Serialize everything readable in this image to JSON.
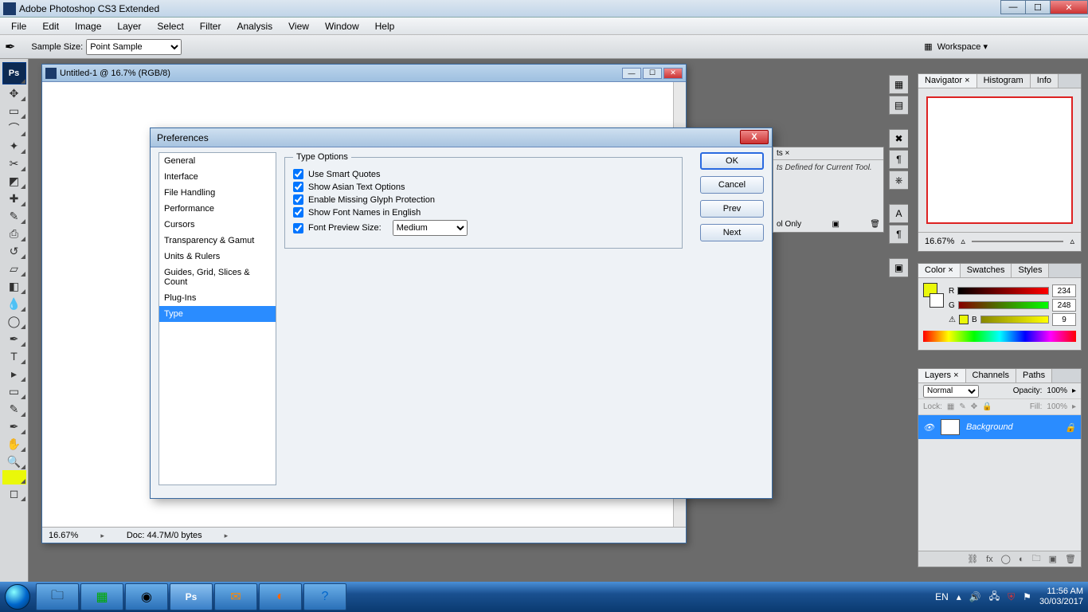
{
  "app": {
    "title": "Adobe Photoshop CS3 Extended"
  },
  "menubar": [
    "File",
    "Edit",
    "Image",
    "Layer",
    "Select",
    "Filter",
    "Analysis",
    "View",
    "Window",
    "Help"
  ],
  "options": {
    "sample_label": "Sample Size:",
    "sample_value": "Point Sample",
    "workspace": "Workspace ▾"
  },
  "doc": {
    "title": "Untitled-1 @ 16.7% (RGB/8)",
    "zoom": "16.67%",
    "docinfo": "Doc: 44.7M/0 bytes"
  },
  "pref": {
    "title": "Preferences",
    "categories": [
      "General",
      "Interface",
      "File Handling",
      "Performance",
      "Cursors",
      "Transparency & Gamut",
      "Units & Rulers",
      "Guides, Grid, Slices & Count",
      "Plug-Ins",
      "Type"
    ],
    "selected": "Type",
    "group": "Type Options",
    "checks": [
      {
        "label": "Use Smart Quotes",
        "checked": true
      },
      {
        "label": "Show Asian Text Options",
        "checked": true
      },
      {
        "label": "Enable Missing Glyph Protection",
        "checked": true
      },
      {
        "label": "Show Font Names in English",
        "checked": true
      }
    ],
    "preview": {
      "label": "Font Preview Size:",
      "checked": true,
      "value": "Medium"
    },
    "buttons": {
      "ok": "OK",
      "cancel": "Cancel",
      "prev": "Prev",
      "next": "Next"
    }
  },
  "toolpreset": {
    "tab": "ts ×",
    "msg": "ts Defined for Current Tool.",
    "only": "ol Only"
  },
  "nav": {
    "tabs": [
      "Navigator ×",
      "Histogram",
      "Info"
    ],
    "zoom": "16.67%"
  },
  "color": {
    "tabs": [
      "Color ×",
      "Swatches",
      "Styles"
    ],
    "r": "234",
    "g": "248",
    "b": "9",
    "fg": "#eaf809"
  },
  "layers": {
    "tabs": [
      "Layers ×",
      "Channels",
      "Paths"
    ],
    "mode": "Normal",
    "opacity_l": "Opacity:",
    "opacity_v": "100%",
    "lock": "Lock:",
    "fill_l": "Fill:",
    "fill_v": "100%",
    "item": "Background"
  },
  "tray": {
    "lang": "EN",
    "time": "11:56 AM",
    "date": "30/03/2017"
  }
}
